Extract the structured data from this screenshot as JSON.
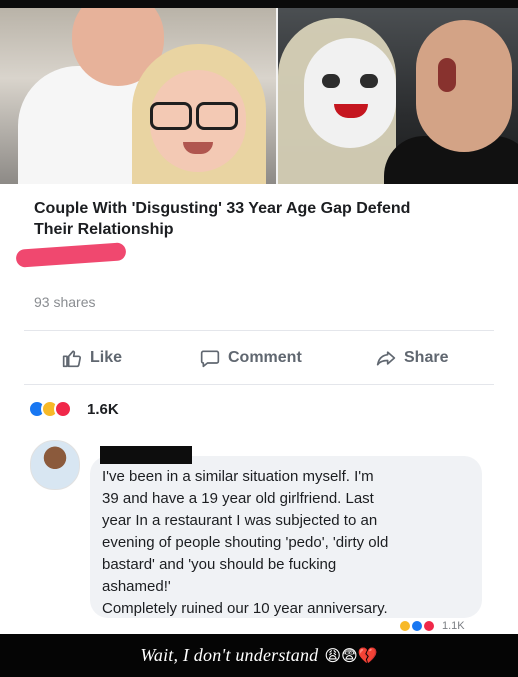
{
  "post": {
    "title_line1": "Couple With 'Disgusting' 33 Year Age Gap Defend",
    "title_line2": "Their Relationship",
    "shares": "93 shares"
  },
  "actions": {
    "like": "Like",
    "comment": "Comment",
    "share": "Share"
  },
  "reactions": {
    "count": "1.6K"
  },
  "comment": {
    "lines": [
      "I've been in a similar situation  myself. I'm",
      "39 and have a 19 year old girlfriend. Last",
      "year In a restaurant I was subjected to an",
      "evening of people shouting 'pedo', 'dirty old",
      "bastard' and 'you should be fucking",
      "ashamed!'",
      "Completely ruined our 10 year anniversary."
    ],
    "reaction_count": "1.1K"
  },
  "caption": {
    "text": "Wait, I don't understand",
    "emoji": "😩😨💔"
  },
  "colors": {
    "facebook_blue": "#1877f2",
    "haha_yellow": "#f7b928",
    "love_red": "#f02849",
    "redaction_pink": "#f0486f"
  }
}
